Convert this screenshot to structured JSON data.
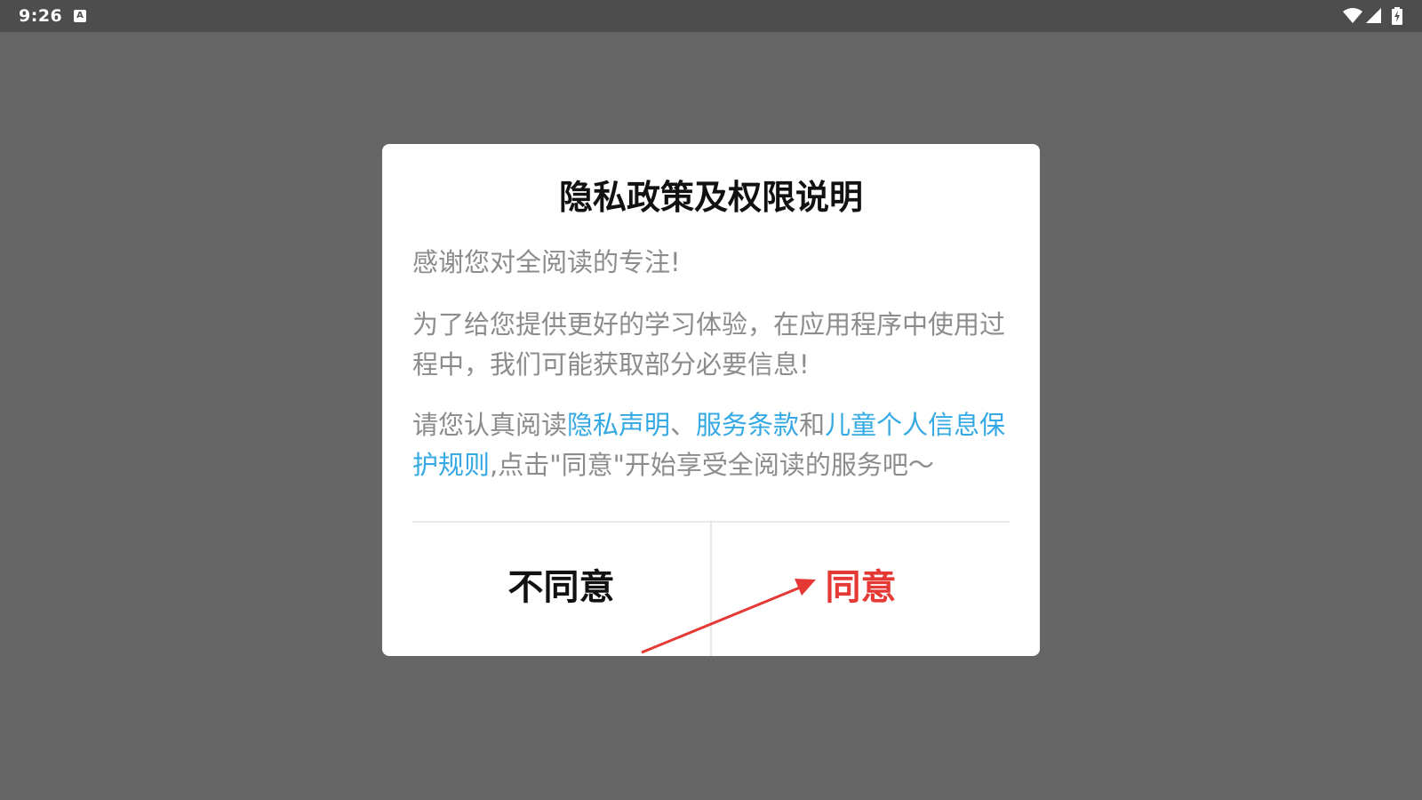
{
  "status_bar": {
    "time": "9:26",
    "notification_icon": "keyboard-a-icon",
    "wifi_icon": "wifi-icon",
    "signal_icon": "cell-signal-icon",
    "battery_icon": "battery-charging-icon"
  },
  "dialog": {
    "title": "隐私政策及权限说明",
    "para1": "感谢您对全阅读的专注!",
    "para2": "为了给您提供更好的学习体验，在应用程序中使用过程中，我们可能获取部分必要信息!",
    "para3": {
      "prefix": "请您认真阅读",
      "link_privacy": "隐私声明",
      "sep1": "、",
      "link_terms": "服务条款",
      "sep2": "和",
      "link_children": "儿童个人信息保护规则",
      "suffix": ",点击\"同意\"开始享受全阅读的服务吧～"
    },
    "buttons": {
      "disagree": "不同意",
      "agree": "同意"
    }
  },
  "colors": {
    "overlay": "#666666",
    "link": "#34a9e3",
    "agree": "#e53935",
    "annotation_arrow": "#e53935"
  }
}
